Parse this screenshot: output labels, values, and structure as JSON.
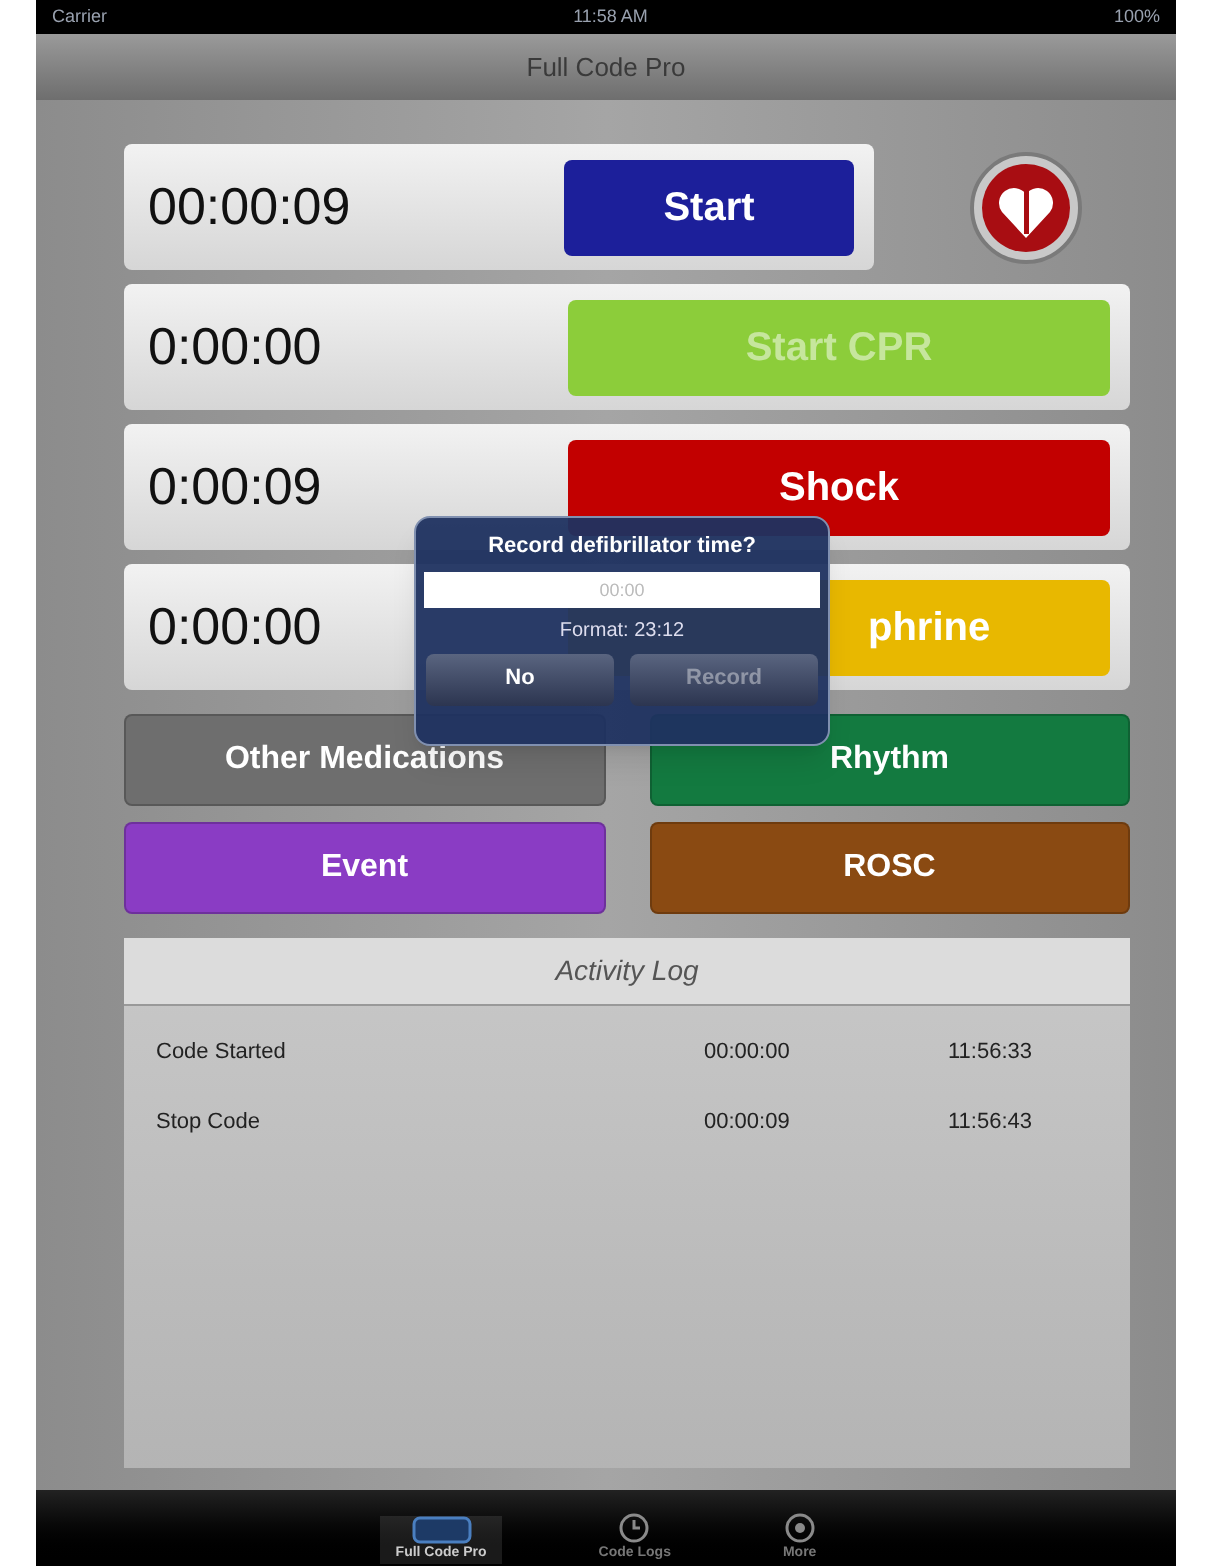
{
  "status_bar": {
    "carrier": "Carrier",
    "time": "11:58 AM",
    "battery": "100%"
  },
  "nav": {
    "title": "Full Code Pro"
  },
  "timers": [
    {
      "time": "00:00:09",
      "button": "Start",
      "color": "#1c1f9a",
      "disabled": false
    },
    {
      "time": "0:00:00",
      "button": "Start CPR",
      "color": "#8ccd3a",
      "disabled": true
    },
    {
      "time": "0:00:09",
      "button": "Shock",
      "color": "#c20000",
      "disabled": false
    },
    {
      "time": "0:00:00",
      "button": "phrine",
      "color": "#e8b800",
      "disabled": false
    }
  ],
  "actions": [
    {
      "label": "Other Medications",
      "color": "#6e6e6e"
    },
    {
      "label": "Rhythm",
      "color": "#137a40"
    },
    {
      "label": "Event",
      "color": "#8a3cc4"
    },
    {
      "label": "ROSC",
      "color": "#8a4a12"
    }
  ],
  "activity_log": {
    "title": "Activity Log",
    "rows": [
      {
        "event": "Code Started",
        "elapsed": "00:00:00",
        "clock": "11:56:33"
      },
      {
        "event": "Stop Code",
        "elapsed": "00:00:09",
        "clock": "11:56:43"
      }
    ]
  },
  "dialog": {
    "title": "Record defibrillator time?",
    "placeholder": "00:00",
    "hint": "Format: 23:12",
    "buttons": [
      {
        "label": "No",
        "disabled": false
      },
      {
        "label": "Record",
        "disabled": true
      }
    ]
  },
  "tab_bar": [
    {
      "label": "Full Code Pro",
      "selected": true
    },
    {
      "label": "Code Logs",
      "selected": false
    },
    {
      "label": "More",
      "selected": false
    }
  ]
}
